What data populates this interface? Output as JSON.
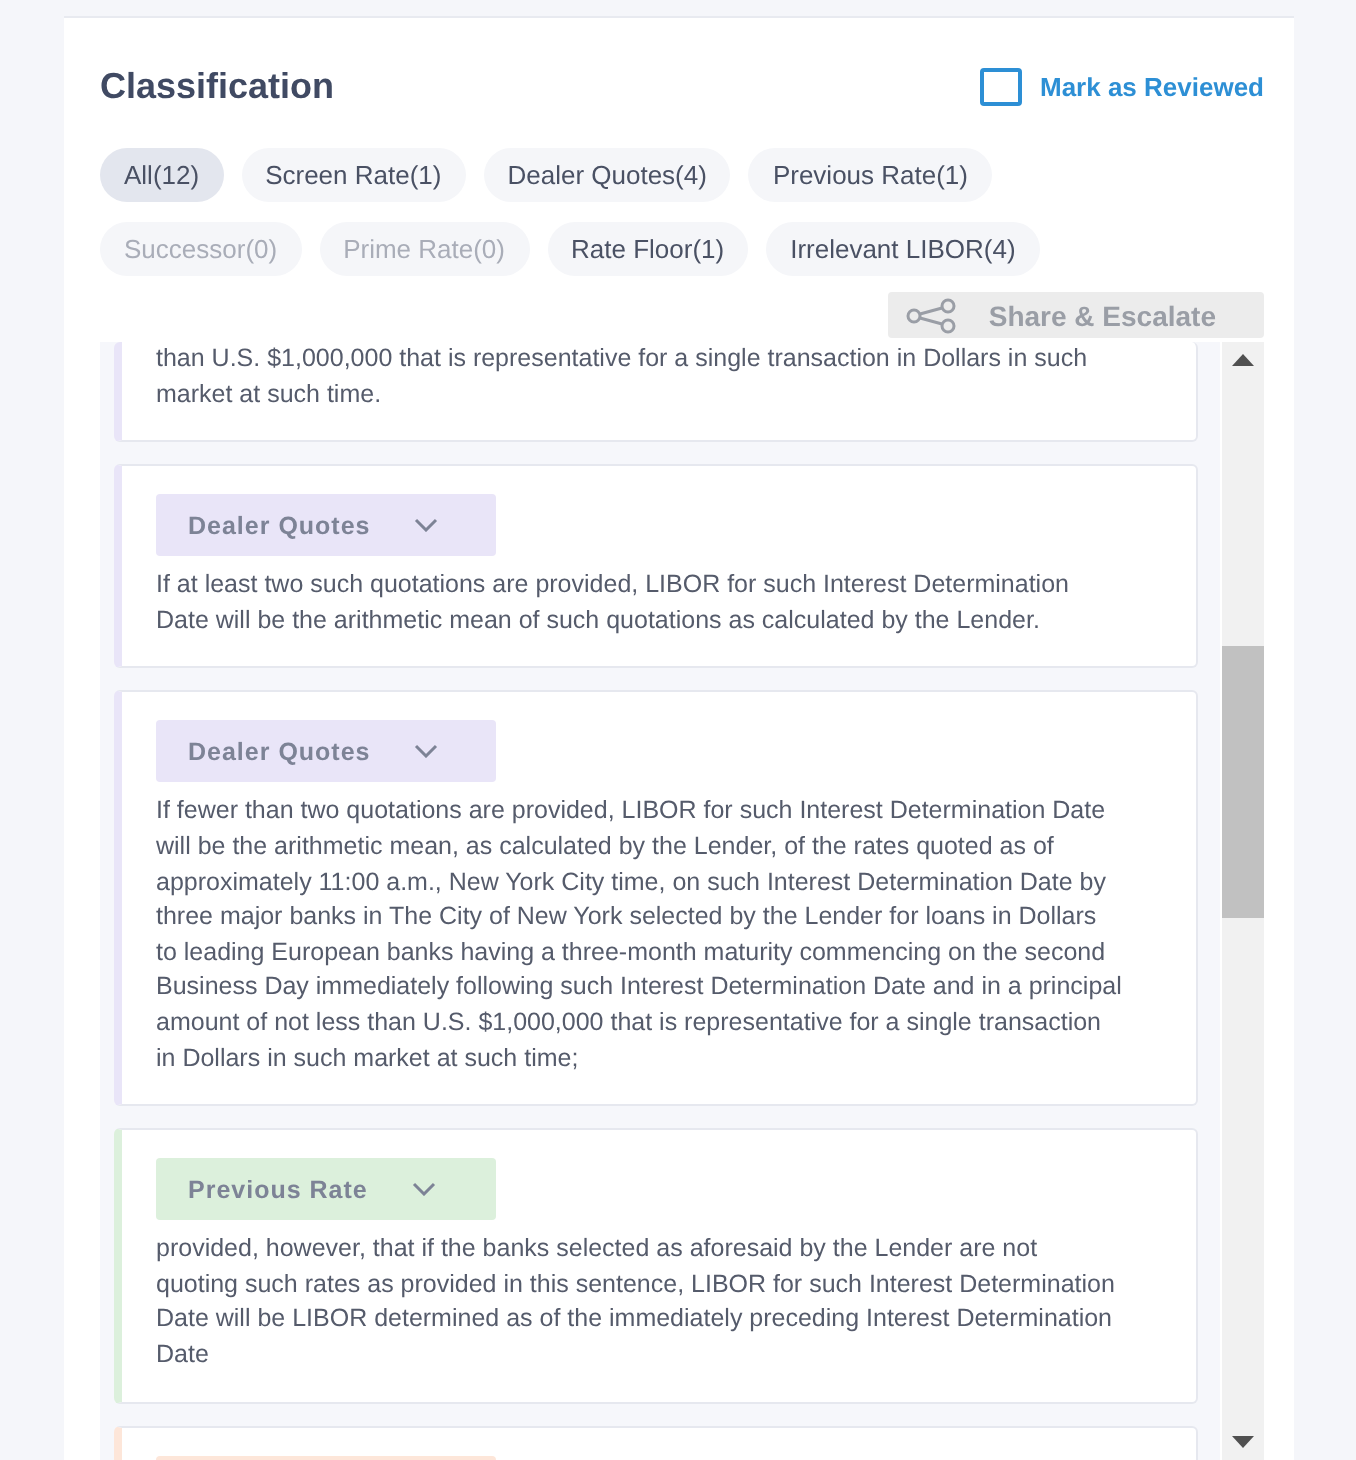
{
  "header": {
    "title": "Classification",
    "review": {
      "label": "Mark as Reviewed",
      "checked": false
    }
  },
  "filters": [
    {
      "label": "All(12)",
      "selected": true,
      "disabled": false
    },
    {
      "label": "Screen Rate(1)",
      "selected": false,
      "disabled": false
    },
    {
      "label": "Dealer Quotes(4)",
      "selected": false,
      "disabled": false
    },
    {
      "label": "Previous Rate(1)",
      "selected": false,
      "disabled": false
    },
    {
      "label": "Successor(0)",
      "selected": false,
      "disabled": true
    },
    {
      "label": "Prime Rate(0)",
      "selected": false,
      "disabled": true
    },
    {
      "label": "Rate Floor(1)",
      "selected": false,
      "disabled": false
    },
    {
      "label": "Irrelevant LIBOR(4)",
      "selected": false,
      "disabled": false
    }
  ],
  "share_button": "Share & Escalate",
  "clauses": [
    {
      "color": "#e9e5f8",
      "text": "than U.S. $1,000,000 that is representative for a single transaction in Dollars in such market at such time."
    },
    {
      "tag": "Dealer Quotes",
      "color": "#e9e5f8",
      "text": "If at least two such quotations are provided, LIBOR for such Interest Determination Date will be the arithmetic mean of such quotations as calculated by the Lender."
    },
    {
      "tag": "Dealer Quotes",
      "color": "#e9e5f8",
      "text": "If fewer than two quotations are provided, LIBOR for such Interest Determination Date will be the arithmetic mean, as calculated by the Lender, of the rates quoted as of approximately 11:00 a.m., New York City time, on such Interest Determination Date by three major banks in The City of New York selected by the Lender for loans in Dollars to leading European banks having a three-month maturity commencing on the second Business Day immediately following such Interest Determination Date and in a principal amount of not less than U.S. $1,000,000 that is representative for a single transaction in Dollars in such market at such time;"
    },
    {
      "tag": "Previous Rate",
      "color": "#dcf0dc",
      "text": "provided, however, that if the banks selected as aforesaid by the Lender are not quoting such rates as provided in this sentence, LIBOR for such Interest Determination Date will be LIBOR determined as of the immediately preceding Interest Determination Date"
    },
    {
      "color": "#fde6d9"
    }
  ]
}
